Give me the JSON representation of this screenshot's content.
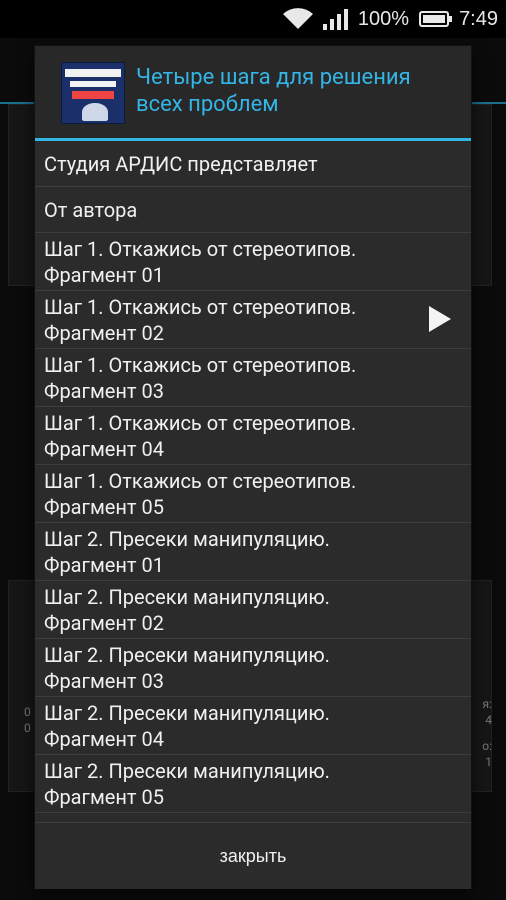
{
  "status_bar": {
    "battery_text": "100%",
    "time": "7:49",
    "icons": [
      "wifi-icon",
      "signal-icon",
      "battery-icon"
    ]
  },
  "background": {
    "left_text_1": "0",
    "left_text_2": "0",
    "right_text_1": "я:",
    "right_text_2": "4",
    "right_text_3": "о:",
    "right_text_4": "1"
  },
  "dialog": {
    "title": "Четыре шага для решения всех проблем",
    "cover_icon": "book-cover-image",
    "items": [
      {
        "line1": "Студия АРДИС представляет",
        "line2": ""
      },
      {
        "line1": "От автора",
        "line2": ""
      },
      {
        "line1": "Шаг 1. Откажись от стереотипов.",
        "line2": "Фрагмент 01"
      },
      {
        "line1": "Шаг 1. Откажись от стереотипов.",
        "line2": "Фрагмент 02",
        "playing": true
      },
      {
        "line1": "Шаг 1. Откажись от стереотипов.",
        "line2": "Фрагмент 03"
      },
      {
        "line1": "Шаг 1. Откажись от стереотипов.",
        "line2": "Фрагмент 04"
      },
      {
        "line1": "Шаг 1. Откажись от стереотипов.",
        "line2": "Фрагмент 05"
      },
      {
        "line1": "Шаг 2. Пресеки манипуляцию.",
        "line2": "Фрагмент 01"
      },
      {
        "line1": "Шаг 2. Пресеки манипуляцию.",
        "line2": "Фрагмент 02"
      },
      {
        "line1": "Шаг 2. Пресеки манипуляцию.",
        "line2": "Фрагмент 03"
      },
      {
        "line1": "Шаг 2. Пресеки манипуляцию.",
        "line2": "Фрагмент 04"
      },
      {
        "line1": "Шаг 2. Пресеки манипуляцию.",
        "line2": "Фрагмент 05"
      }
    ],
    "close_label": "закрыть"
  },
  "colors": {
    "accent": "#33b5e5",
    "dialog_bg": "#2b2b2b",
    "divider": "#3d3d3d"
  }
}
